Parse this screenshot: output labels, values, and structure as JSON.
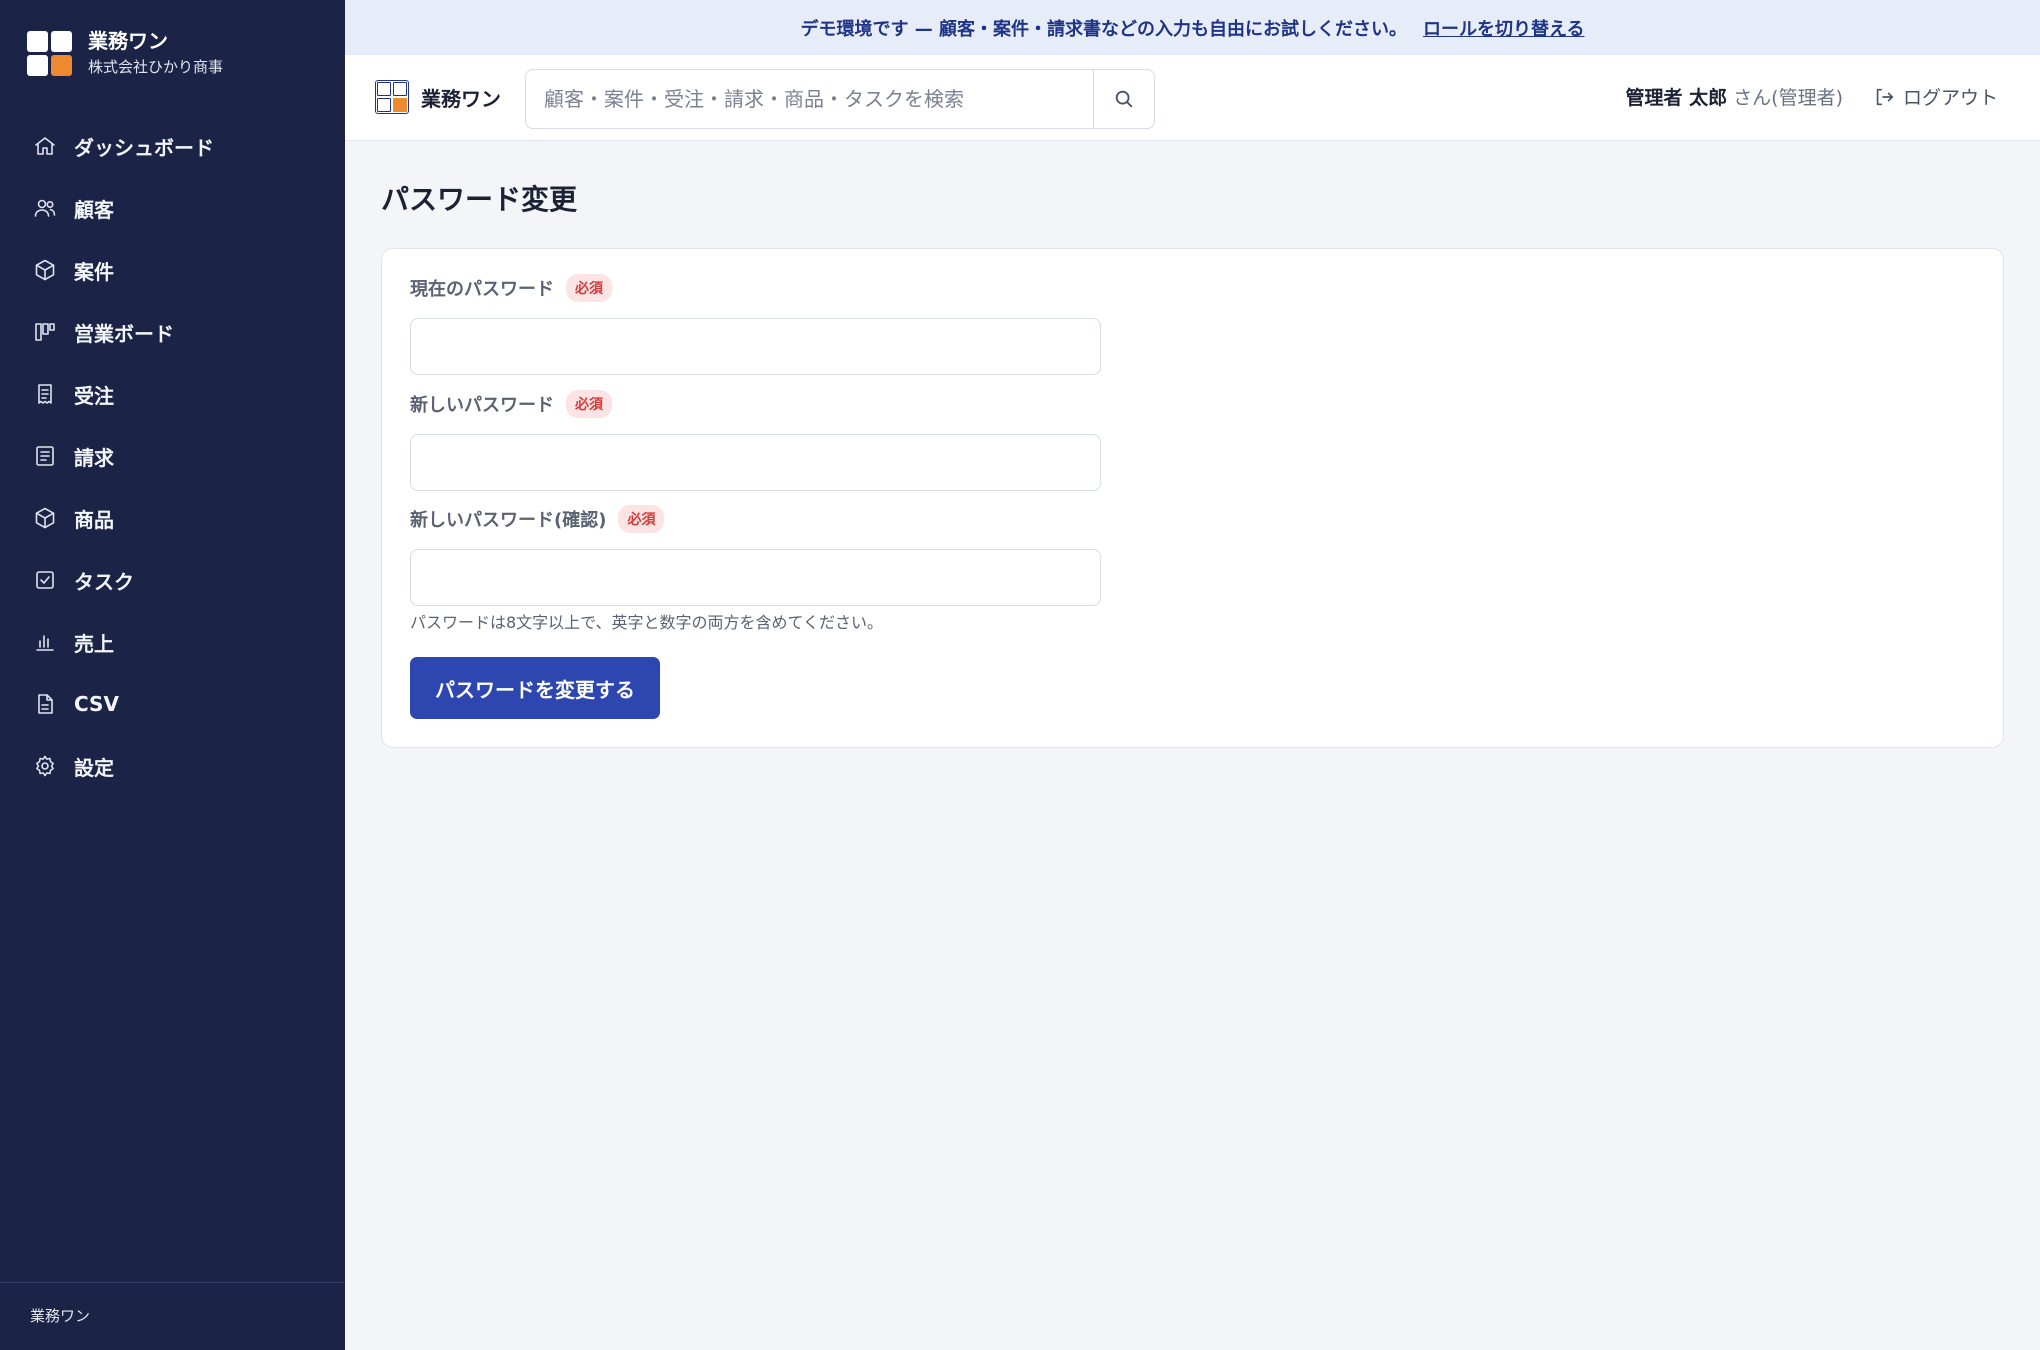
{
  "brand": {
    "name": "業務ワン",
    "company": "株式会社ひかり商事"
  },
  "sidebar": {
    "items": [
      {
        "label": "ダッシュボード",
        "icon": "home-icon"
      },
      {
        "label": "顧客",
        "icon": "users-icon"
      },
      {
        "label": "案件",
        "icon": "box-icon"
      },
      {
        "label": "営業ボード",
        "icon": "kanban-icon"
      },
      {
        "label": "受注",
        "icon": "receipt-icon"
      },
      {
        "label": "請求",
        "icon": "document-icon"
      },
      {
        "label": "商品",
        "icon": "package-icon"
      },
      {
        "label": "タスク",
        "icon": "checkbox-icon"
      },
      {
        "label": "売上",
        "icon": "bar-chart-icon"
      },
      {
        "label": "CSV",
        "icon": "file-icon"
      },
      {
        "label": "設定",
        "icon": "gear-icon"
      }
    ],
    "footer": "業務ワン"
  },
  "banner": {
    "text": "デモ環境です — 顧客・案件・請求書などの入力も自由にお試しください。",
    "link": "ロールを切り替える"
  },
  "topbar": {
    "logo_name": "業務ワン",
    "search_placeholder": "顧客・案件・受注・請求・商品・タスクを検索",
    "user_name": "管理者 太郎",
    "user_role": "さん(管理者)",
    "logout": "ログアウト"
  },
  "page": {
    "title": "パスワード変更",
    "fields": [
      {
        "label": "現在のパスワード",
        "required": "必須"
      },
      {
        "label": "新しいパスワード",
        "required": "必須"
      },
      {
        "label": "新しいパスワード(確認)",
        "required": "必須"
      }
    ],
    "help": "パスワードは8文字以上で、英字と数字の両方を含めてください。",
    "submit": "パスワードを変更する"
  },
  "colors": {
    "sidebar_bg": "#1b2347",
    "accent": "#2d46b0",
    "brand_orange": "#ee8a2e",
    "banner_bg": "#e7edf8",
    "required_badge": "#d43c3c"
  }
}
